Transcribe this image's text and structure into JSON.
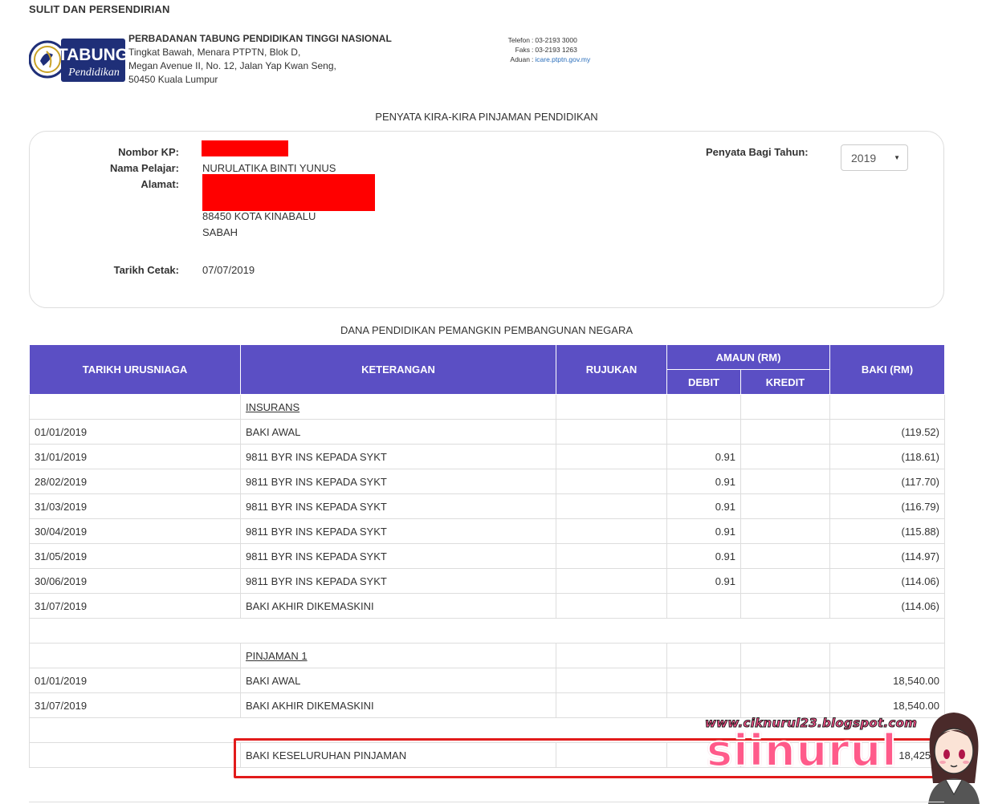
{
  "header": {
    "confidential": "SULIT DAN PERSENDIRIAN",
    "logo": {
      "icon": "ptptn-seal-logo",
      "text_top": "TABUNG",
      "text_bottom": "Pendidikan"
    },
    "org": {
      "name": "PERBADANAN TABUNG PENDIDIKAN TINGGI NASIONAL",
      "address": [
        "Tingkat Bawah, Menara PTPTN, Blok D,",
        "Megan Avenue II, No. 12, Jalan Yap Kwan Seng,",
        "50450 Kuala Lumpur"
      ]
    },
    "contact": [
      {
        "label": "Telefon",
        "value": "03-2193 3000"
      },
      {
        "label": "Faks",
        "value": "03-2193 1263"
      },
      {
        "label": "Aduan",
        "value": "icare.ptptn.gov.my"
      }
    ]
  },
  "statement_title": "PENYATA KIRA-KIRA PINJAMAN PENDIDIKAN",
  "info": {
    "nombor_kp_label": "Nombor KP:",
    "nama_label": "Nama Pelajar:",
    "nama_value": "NURULATIKA BINTI YUNUS",
    "alamat_label": "Alamat:",
    "alamat_lines": [
      "88450 KOTA KINABALU",
      "SABAH"
    ],
    "tarikh_label": "Tarikh Cetak:",
    "tarikh_value": "07/07/2019",
    "year_label": "Penyata Bagi Tahun:",
    "year_value": "2019"
  },
  "fund_title": "DANA PENDIDIKAN PEMANGKIN PEMBANGUNAN NEGARA",
  "table": {
    "headers": {
      "tarikh": "TARIKH URUSNIAGA",
      "keterangan": "KETERANGAN",
      "rujukan": "RUJUKAN",
      "amaun": "AMAUN (RM)",
      "debit": "DEBIT",
      "kredit": "KREDIT",
      "baki": "BAKI (RM)"
    },
    "rows": [
      {
        "type": "section",
        "date": "",
        "desc": "INSURANS ",
        "ref": "",
        "debit": "",
        "credit": "",
        "balance": ""
      },
      {
        "type": "data",
        "date": "01/01/2019",
        "desc": "BAKI AWAL",
        "ref": "",
        "debit": "",
        "credit": "",
        "balance": "(119.52)"
      },
      {
        "type": "data",
        "date": "31/01/2019",
        "desc": "9811 BYR INS KEPADA SYKT",
        "ref": "",
        "debit": "0.91",
        "credit": "",
        "balance": "(118.61)"
      },
      {
        "type": "data",
        "date": "28/02/2019",
        "desc": "9811 BYR INS KEPADA SYKT",
        "ref": "",
        "debit": "0.91",
        "credit": "",
        "balance": "(117.70)"
      },
      {
        "type": "data",
        "date": "31/03/2019",
        "desc": "9811 BYR INS KEPADA SYKT",
        "ref": "",
        "debit": "0.91",
        "credit": "",
        "balance": "(116.79)"
      },
      {
        "type": "data",
        "date": "30/04/2019",
        "desc": "9811 BYR INS KEPADA SYKT",
        "ref": "",
        "debit": "0.91",
        "credit": "",
        "balance": "(115.88)"
      },
      {
        "type": "data",
        "date": "31/05/2019",
        "desc": "9811 BYR INS KEPADA SYKT",
        "ref": "",
        "debit": "0.91",
        "credit": "",
        "balance": "(114.97)"
      },
      {
        "type": "data",
        "date": "30/06/2019",
        "desc": "9811 BYR INS KEPADA SYKT",
        "ref": "",
        "debit": "0.91",
        "credit": "",
        "balance": "(114.06)"
      },
      {
        "type": "data",
        "date": "31/07/2019",
        "desc": "BAKI AKHIR DIKEMASKINI",
        "ref": "",
        "debit": "",
        "credit": "",
        "balance": "(114.06)"
      },
      {
        "type": "gap"
      },
      {
        "type": "section",
        "date": "",
        "desc": "PINJAMAN 1 ",
        "ref": "",
        "debit": "",
        "credit": "",
        "balance": ""
      },
      {
        "type": "data",
        "date": "01/01/2019",
        "desc": "BAKI AWAL",
        "ref": "",
        "debit": "",
        "credit": "",
        "balance": "18,540.00"
      },
      {
        "type": "data",
        "date": "31/07/2019",
        "desc": "BAKI AKHIR DIKEMASKINI",
        "ref": "",
        "debit": "",
        "credit": "",
        "balance": "18,540.00"
      },
      {
        "type": "gap"
      },
      {
        "type": "data",
        "date": "",
        "desc": "BAKI KESELURUHAN PINJAMAN",
        "ref": "",
        "debit": "",
        "credit": "",
        "balance": "18,425.9"
      }
    ]
  },
  "watermark": {
    "url": "www.ciknurul23.blogspot.com",
    "brand": "siinurul",
    "avatar_icon": "cartoon-girl-avatar"
  },
  "colors": {
    "header_bg": "#5b4fc4",
    "highlight": "#e21b1b",
    "redaction": "#ff0000",
    "watermark": "#ff5a8a"
  }
}
